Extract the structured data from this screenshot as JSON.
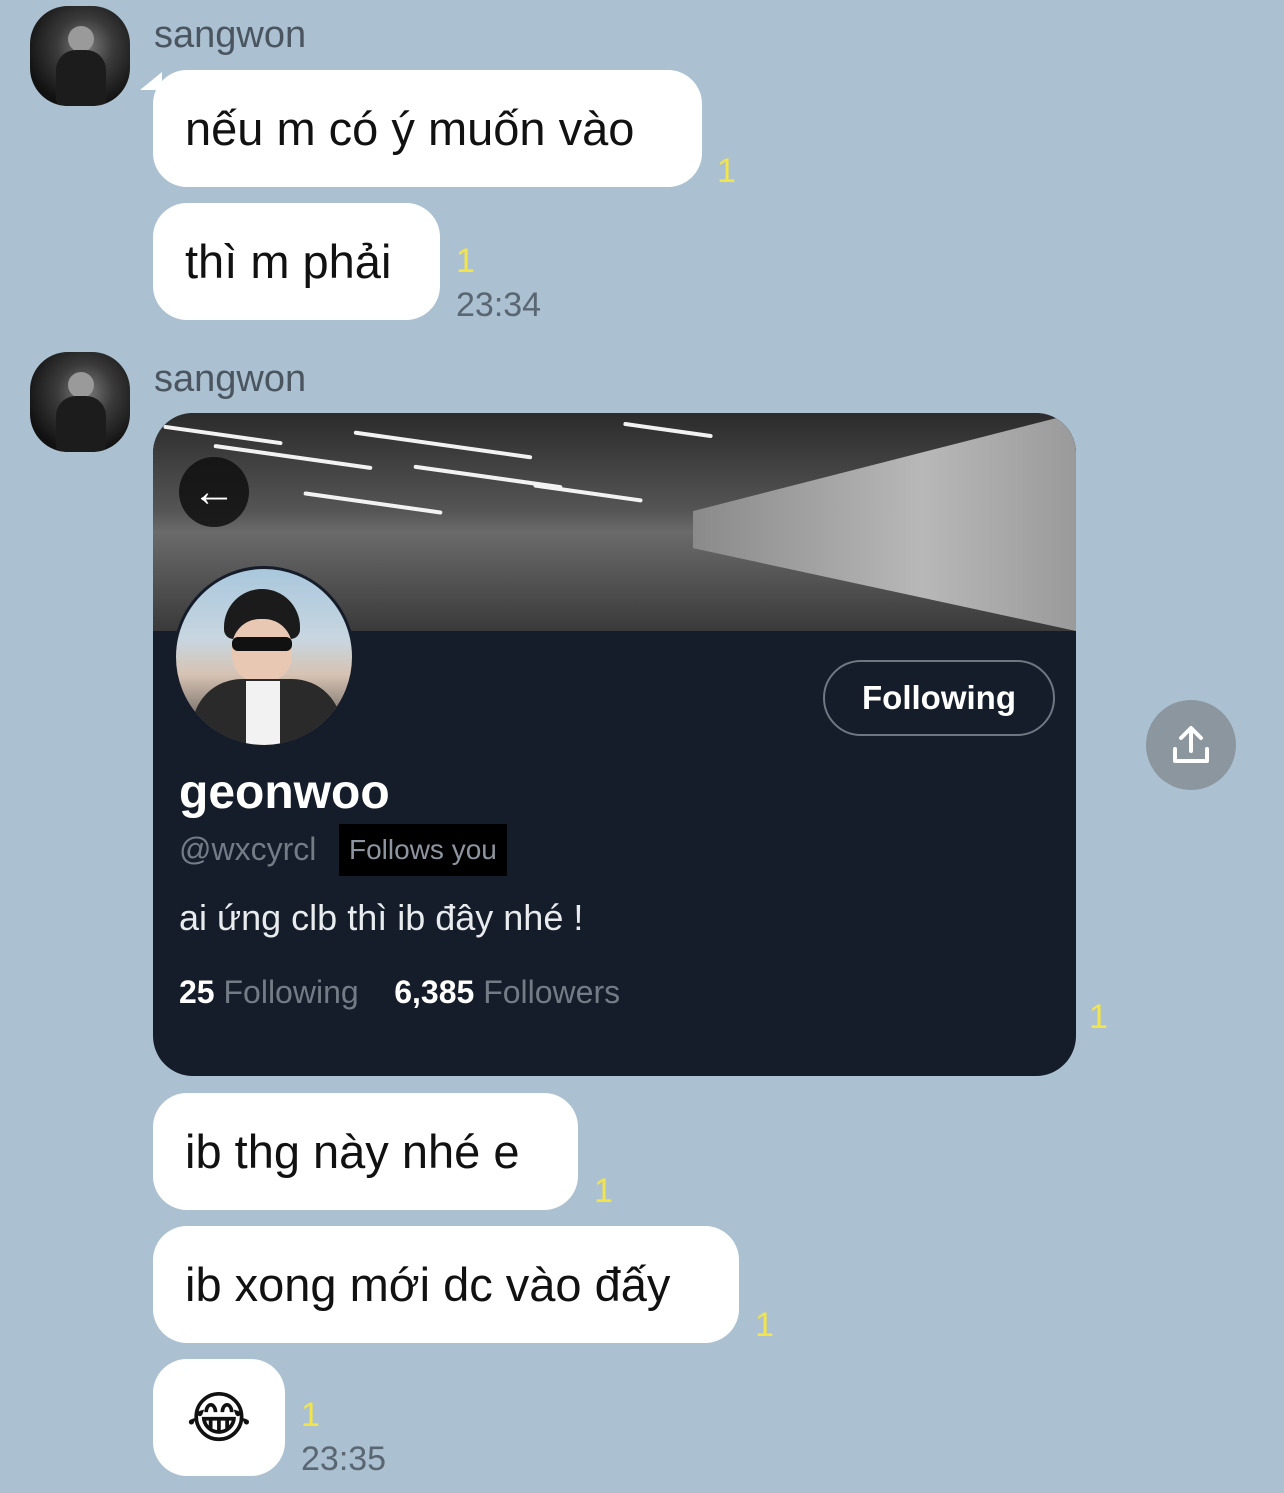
{
  "groups": [
    {
      "sender": "sangwon",
      "messages": [
        {
          "text": "nếu m có ý muốn vào",
          "unread": "1"
        },
        {
          "text": "thì m phải",
          "unread": "1",
          "time": "23:34"
        }
      ]
    },
    {
      "sender": "sangwon",
      "profile_card": {
        "display_name": "geonwoo",
        "handle": "@wxcyrcl",
        "follows_you": "Follows you",
        "follow_button": "Following",
        "bio": "ai ứng clb thì ib đây nhé !",
        "following_count": "25",
        "following_label": "Following",
        "followers_count": "6,385",
        "followers_label": "Followers",
        "back_icon": "arrow-left-icon",
        "unread": "1"
      },
      "messages": [
        {
          "text": "ib thg này nhé e",
          "unread": "1"
        },
        {
          "text": "ib xong mới dc vào đấy",
          "unread": "1"
        },
        {
          "text": "😂",
          "unread": "1",
          "time": "23:35"
        }
      ]
    }
  ],
  "share_icon": "share-upload-icon",
  "colors": {
    "background": "#abc1d1",
    "bubble": "#ffffff",
    "unread": "#f3e44a",
    "card": "#161d2a"
  }
}
